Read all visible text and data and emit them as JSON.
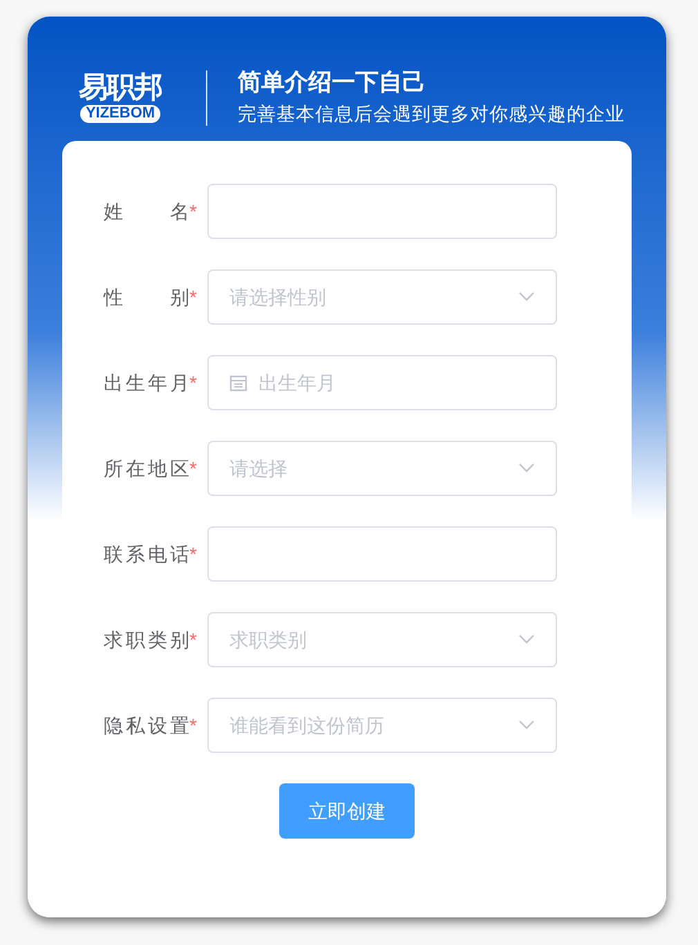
{
  "logo": {
    "name": "易职邦",
    "subtitle": "YIZEBOM"
  },
  "header": {
    "title": "简单介绍一下自己",
    "subtitle": "完善基本信息后会遇到更多对你感兴趣的企业"
  },
  "fields": [
    {
      "label": "姓名",
      "required": "*",
      "kind": "text"
    },
    {
      "label": "性别",
      "required": "*",
      "kind": "select",
      "placeholder": "请选择性别"
    },
    {
      "label": "出生年月",
      "required": "*",
      "kind": "date",
      "placeholder": "出生年月"
    },
    {
      "label": "所在地区",
      "required": "*",
      "kind": "select",
      "placeholder": "请选择"
    },
    {
      "label": "联系电话",
      "required": "*",
      "kind": "text"
    },
    {
      "label": "求职类别",
      "required": "*",
      "kind": "select",
      "placeholder": "求职类别"
    },
    {
      "label": "隐私设置",
      "required": "*",
      "kind": "select",
      "placeholder": "谁能看到这份简历"
    }
  ],
  "submit": "立即创建"
}
